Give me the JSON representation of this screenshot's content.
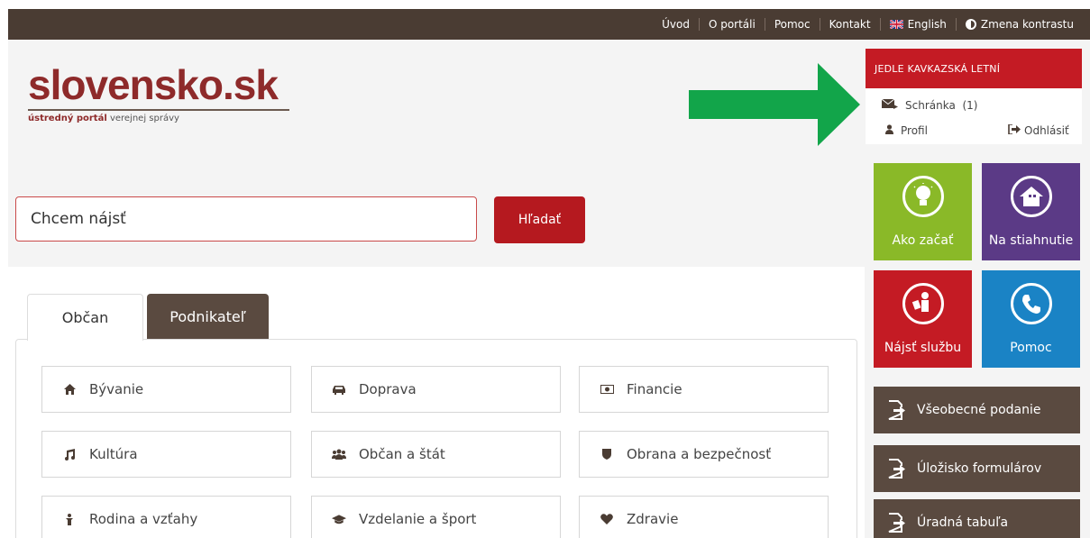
{
  "topnav": {
    "uvod": "Úvod",
    "o_portali": "O portáli",
    "pomoc": "Pomoc",
    "kontakt": "Kontakt",
    "english": "English",
    "kontrast": "Zmena kontrastu"
  },
  "logo": {
    "title": "slovensko.sk",
    "subtitle_bold": "ústredný portál",
    "subtitle_rest": " verejnej správy"
  },
  "search": {
    "value": "Chcem nájsť",
    "button": "Hľadať"
  },
  "tabs": [
    {
      "label": "Občan"
    },
    {
      "label": "Podnikateľ"
    }
  ],
  "categories": [
    {
      "label": "Bývanie",
      "icon": "home-icon"
    },
    {
      "label": "Doprava",
      "icon": "car-icon"
    },
    {
      "label": "Financie",
      "icon": "money-icon"
    },
    {
      "label": "Kultúra",
      "icon": "music-icon"
    },
    {
      "label": "Občan a štát",
      "icon": "people-icon"
    },
    {
      "label": "Obrana a bezpečnosť",
      "icon": "shield-icon"
    },
    {
      "label": "Rodina a vzťahy",
      "icon": "family-icon"
    },
    {
      "label": "Vzdelanie a šport",
      "icon": "graduation-cap-icon"
    },
    {
      "label": "Zdravie",
      "icon": "heart-icon"
    }
  ],
  "user": {
    "name": "JEDLE KAVKAZSKÁ LETNÍ",
    "mailbox": "Schránka",
    "mailbox_count": "(1)",
    "profile": "Profil",
    "logout": "Odhlásiť"
  },
  "tiles": [
    {
      "label": "Ako začať",
      "color": "#8ab928",
      "icon": "lightbulb-icon"
    },
    {
      "label": "Na stiahnutie",
      "color": "#5b3a86",
      "icon": "download-house-icon"
    },
    {
      "label": "Nájsť službu",
      "color": "#c41b24",
      "icon": "person-service-icon"
    },
    {
      "label": "Pomoc",
      "color": "#1a83c5",
      "icon": "phone-icon"
    }
  ],
  "links": [
    {
      "label": "Všeobecné podanie"
    },
    {
      "label": "Úložisko formulárov"
    },
    {
      "label": "Úradná tabuľa"
    }
  ],
  "colors": {
    "topbar": "#4a3c33",
    "brand_red": "#b5191f",
    "arrow": "#12a54a",
    "brown": "#5a4a40"
  }
}
